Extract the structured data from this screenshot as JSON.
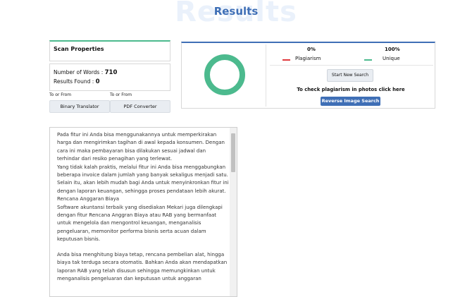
{
  "watermark": "Results",
  "title": "Results",
  "scan": {
    "title": "Scan Properties",
    "words_label": "Number of Words :",
    "words_value": "710",
    "results_label": "Results Found :",
    "results_value": "0"
  },
  "converters": [
    {
      "label": "To or From",
      "button": "Binary Translator"
    },
    {
      "label": "To or From",
      "button": "PDF Converter"
    }
  ],
  "result": {
    "plag_pct": "0%",
    "plag_label": "Plagiarism",
    "unique_pct": "100%",
    "unique_label": "Unique",
    "unique_fraction": 1.0,
    "start_button": "Start New Search",
    "photo_text": "To check plagiarism in photos click here",
    "reverse_button": "Reverse Image Search"
  },
  "colors": {
    "accent": "#3f6fb6",
    "unique": "#4cba8e",
    "plagiarism": "#e0393e"
  },
  "text_lines": [
    "Pada fitur ini Anda bisa menggunakannya untuk memperkirakan",
    "harga dan mengirimkan tagihan di awal kepada konsumen. Dengan",
    "cara ini maka pembayaran bisa dilakukan sesuai jadwal dan",
    "terhindar dari resiko penagihan yang terlewat.",
    "Yang tidak kalah praktis, melalui fitur ini Anda bisa menggabungkan",
    "beberapa invoice dalam jumlah yang banyak sekaligus menjadi satu.",
    "Selain itu, akan lebih mudah bagi Anda untuk menyinkronkan fitur ini",
    "dengan laporan keuangan, sehingga proses pendataan lebih akurat.",
    "Rencana Anggaran Biaya",
    "Software akuntansi terbaik yang disediakan Mekari juga dilengkapi",
    "dengan fitur Rencana Anggran Biaya atau RAB yang bermanfaat",
    "untuk mengelola dan mengontrol keuangan, menganalisis",
    "pengeluaran, memonitor performa bisnis serta acuan dalam",
    "keputusan bisnis.",
    "",
    "Anda bisa menghitung biaya tetap, rencana pembelian alat, hingga",
    "biaya tak terduga secara otomatis. Bahkan Anda akan mendapatkan",
    "laporan RAB yang telah disusun sehingga memungkinkan untuk",
    "menganalisis pengeluaran dan keputusan untuk anggaran"
  ]
}
